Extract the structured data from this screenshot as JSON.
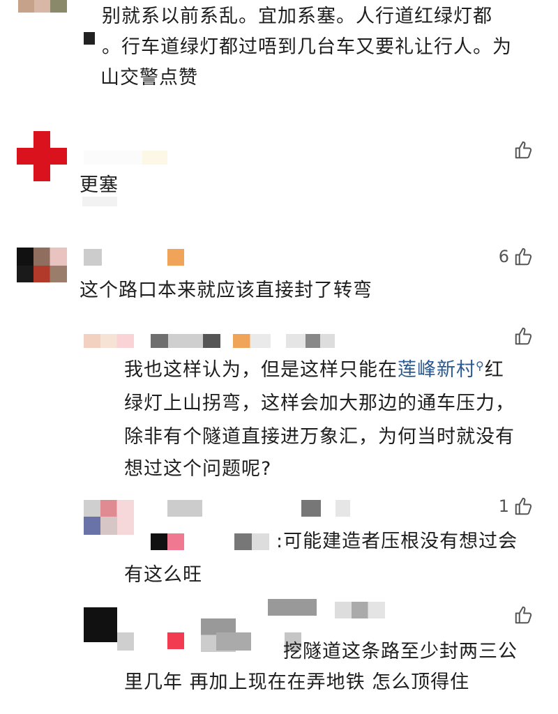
{
  "colors": {
    "text": "#1e1e1e",
    "link": "#2b5a92",
    "muted": "#555555",
    "red_cross": "#d9121e"
  },
  "comments": [
    {
      "text_lines": [
        " 别就系以前系乱。宜加系塞。人行道红绿灯都",
        " 。行车道绿灯都过唔到几台车又要礼让行人。为",
        "山交警点赞"
      ]
    },
    {
      "likes": "",
      "text": "更塞"
    },
    {
      "likes": "6",
      "text": "这个路口本来就应该直接封了转弯"
    }
  ],
  "replies": [
    {
      "likes": "",
      "line1_pre": "我也这样认为，但是这样只能在",
      "line1_link": "莲峰新村",
      "line1_post": "红",
      "lines": [
        "绿灯上山拐弯，这样会加大那边的通车压力，",
        "除非有个隧道直接进万象汇，为何当时就没有",
        "想过这个问题呢?"
      ],
      "link_icon": "search-icon"
    },
    {
      "likes": "1",
      "line1": ":可能建造者压根没有想过会",
      "line2": "有这么旺"
    },
    {
      "likes": "",
      "line1": "挖隧道这条路至少封两三公",
      "line2": "里几年 再加上现在在弄地铁 怎么顶得住"
    }
  ],
  "icons": {
    "like": "thumbs-up-icon"
  }
}
